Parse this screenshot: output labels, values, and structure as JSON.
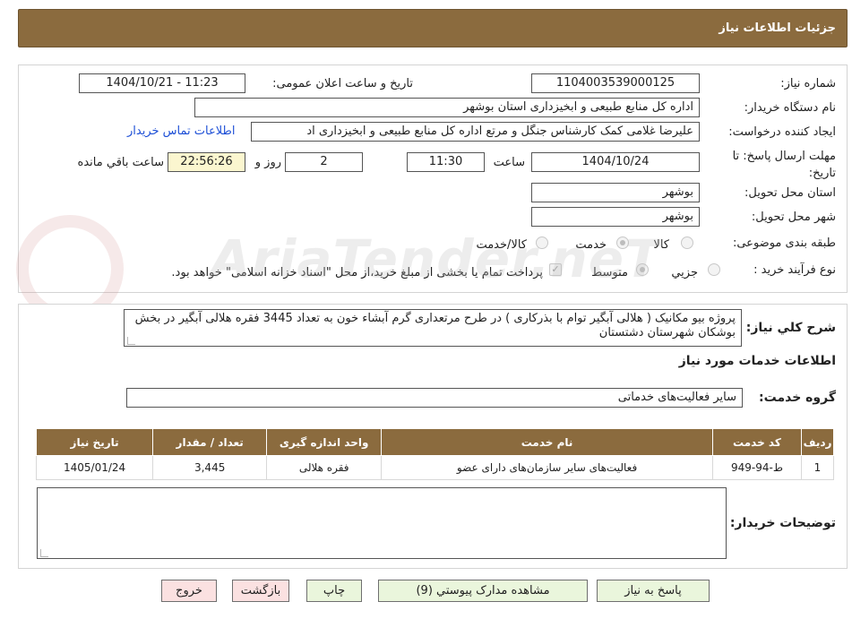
{
  "header": {
    "title": "جزئیات اطلاعات نیاز"
  },
  "form": {
    "need_number_label": "شماره نیاز:",
    "need_number": "1104003539000125",
    "announce_label": "تاریخ و ساعت اعلان عمومی:",
    "announce_value": "1404/10/21 - 11:23",
    "buyer_org_label": "نام دستگاه خریدار:",
    "buyer_org": "اداره کل منابع طبیعی و ابخیزداری استان بوشهر",
    "creator_label": "ایجاد کننده درخواست:",
    "creator": "علیرضا غلامی کمک کارشناس جنگل و مرتع اداره کل منابع طبیعی و ابخیزداری اد",
    "contact_link": "اطلاعات تماس خریدار",
    "deadline_label": "مهلت ارسال پاسخ: تا تاریخ:",
    "deadline_date": "1404/10/24",
    "time_label": "ساعت",
    "deadline_time": "11:30",
    "days_value": "2",
    "days_label": "روز و",
    "remaining_time": "22:56:26",
    "remaining_label": "ساعت باقي مانده",
    "province_label": "استان محل تحویل:",
    "province": "بوشهر",
    "city_label": "شهر محل تحویل:",
    "city": "بوشهر",
    "category_label": "طبقه بندی موضوعی:",
    "category_options": [
      "کالا",
      "خدمت",
      "کالا/خدمت"
    ],
    "category_selected": "خدمت",
    "process_label": "نوع فرآیند خرید :",
    "process_options": [
      "جزيي",
      "متوسط"
    ],
    "process_selected": "متوسط",
    "payment_note": "پرداخت تمام یا بخشی از مبلغ خرید،از محل \"اسناد خزانه اسلامی\" خواهد بود.",
    "payment_checked": true
  },
  "details": {
    "summary_label": "شرح کلي نياز:",
    "summary": "پروژه بیو مکانیک ( هلالی آبگیر توام با بذرکاری ) در طرح مرتعداری گرم آبشاء خون به تعداد 3445 فقره هلالی آبگیر در بخش بوشکان شهرستان دشتستان",
    "services_title": "اطلاعات خدمات مورد نیاز",
    "service_group_label": "گروه خدمت:",
    "service_group": "سایر فعالیت‌های خدماتی",
    "table": {
      "headers": [
        "ردیف",
        "کد خدمت",
        "نام خدمت",
        "واحد اندازه گیری",
        "تعداد / مقدار",
        "تاریخ نیاز"
      ],
      "rows": [
        [
          "1",
          "ط-94-949",
          "فعالیت‌های سایر سازمان‌های دارای عضو",
          "فقره هلالی",
          "3,445",
          "1405/01/24"
        ]
      ]
    },
    "buyer_notes_label": "توضیحات خریدار:",
    "buyer_notes": ""
  },
  "buttons": {
    "reply": "پاسخ به نیاز",
    "attachments": "مشاهده مدارک پیوستي (9)",
    "print": "چاپ",
    "back": "بازگشت",
    "exit": "خروج"
  },
  "watermark": {
    "text": "AriaTender.neT"
  }
}
